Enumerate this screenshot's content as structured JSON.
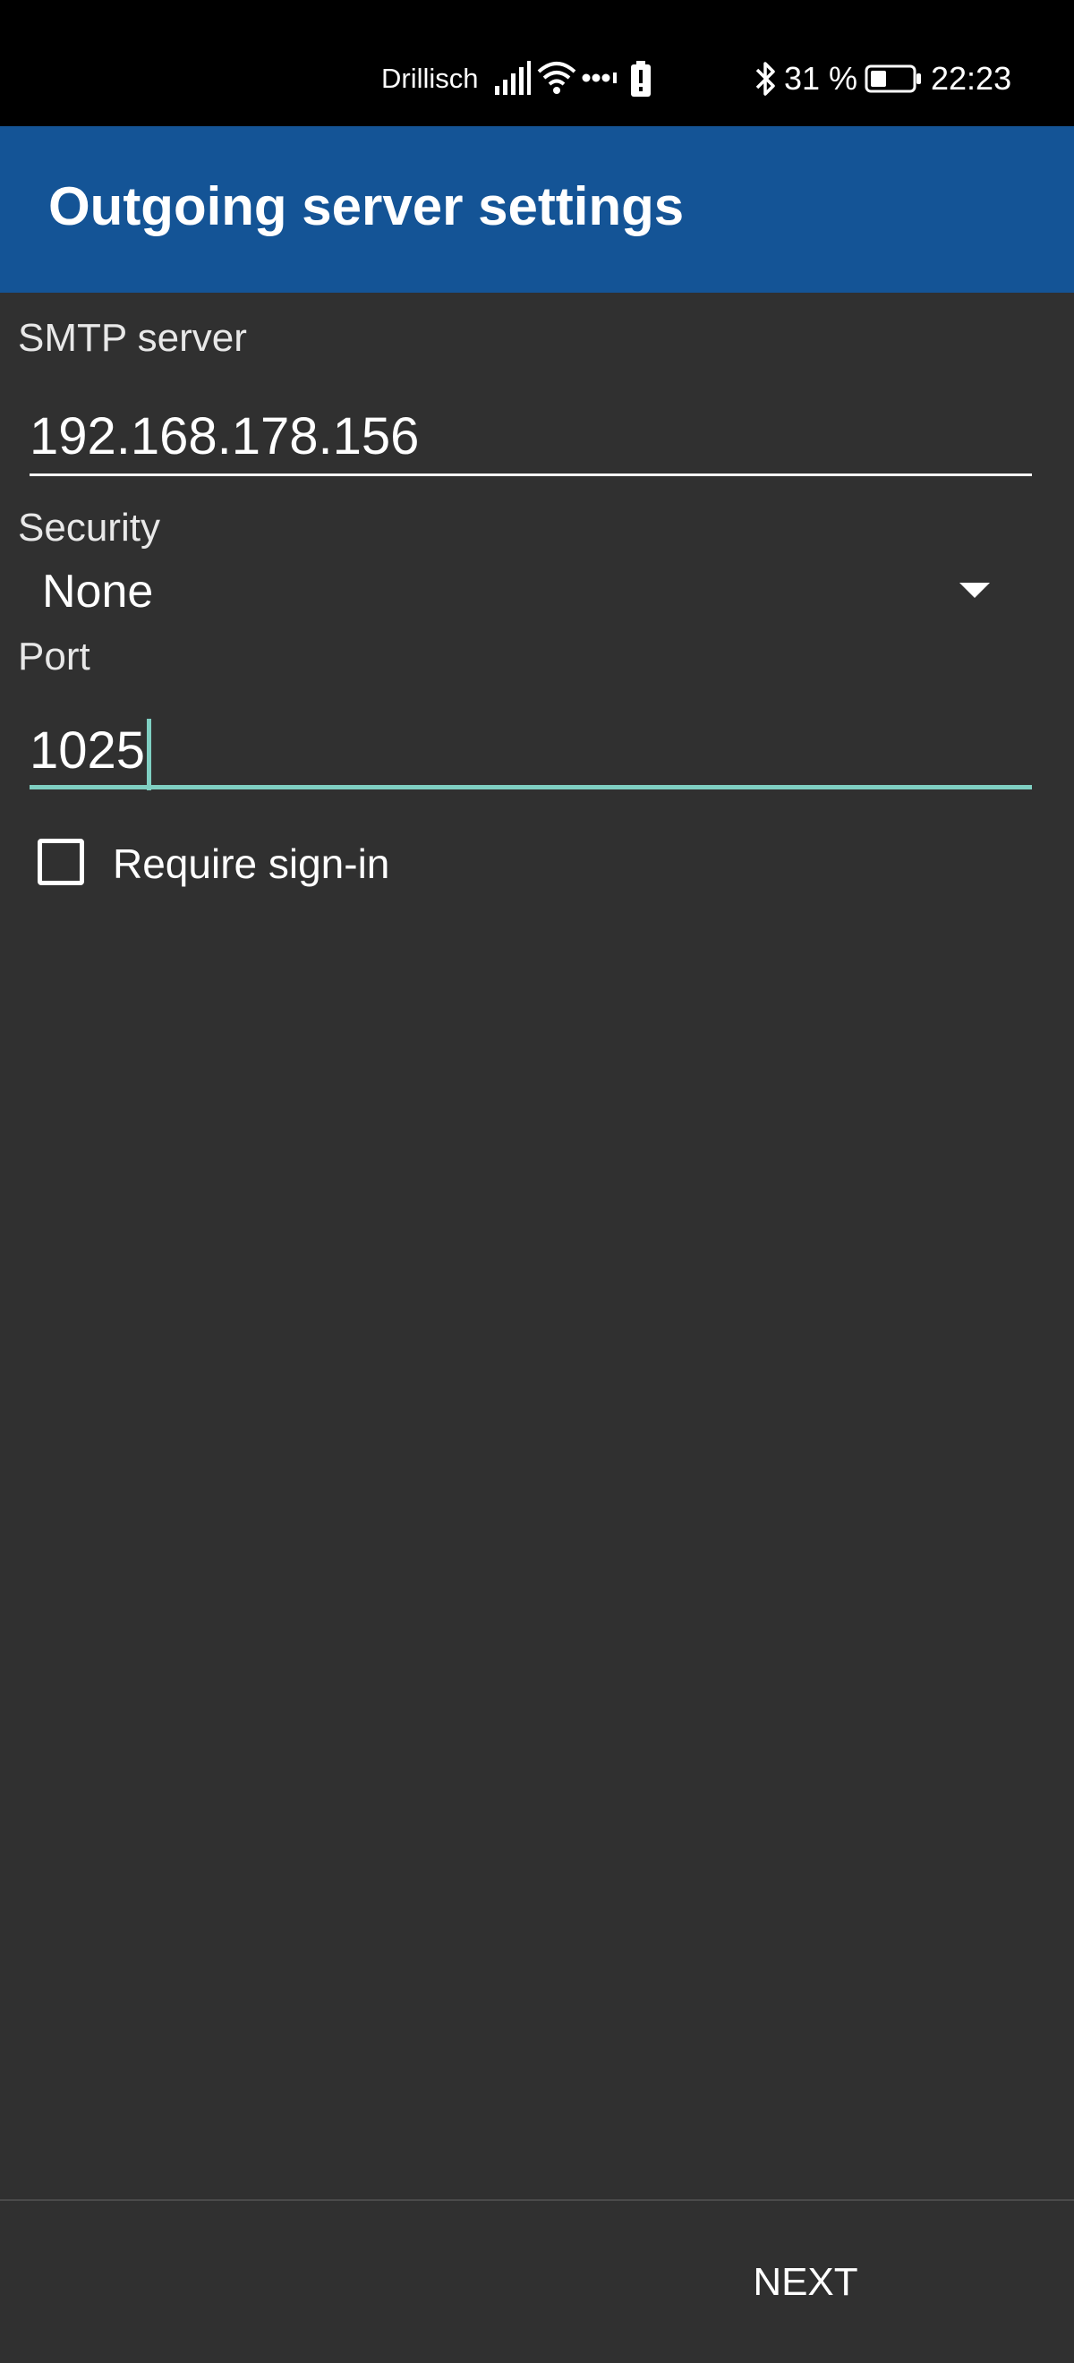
{
  "status_bar": {
    "carrier": "Drillisch",
    "battery_percent": "31 %",
    "time": "22:23",
    "icons": [
      "signal-icon",
      "wifi-icon",
      "more-dots-icon",
      "alert-battery-icon",
      "bluetooth-icon",
      "battery-icon"
    ]
  },
  "app_bar": {
    "title": "Outgoing server settings",
    "color": "#145496"
  },
  "form": {
    "smtp_label": "SMTP server",
    "smtp_value": "192.168.178.156",
    "security_label": "Security",
    "security_value": "None",
    "port_label": "Port",
    "port_value": "1025",
    "require_signin_label": "Require sign-in",
    "require_signin_checked": false,
    "focus_color": "#7fcfc2"
  },
  "footer": {
    "next_label": "NEXT"
  }
}
